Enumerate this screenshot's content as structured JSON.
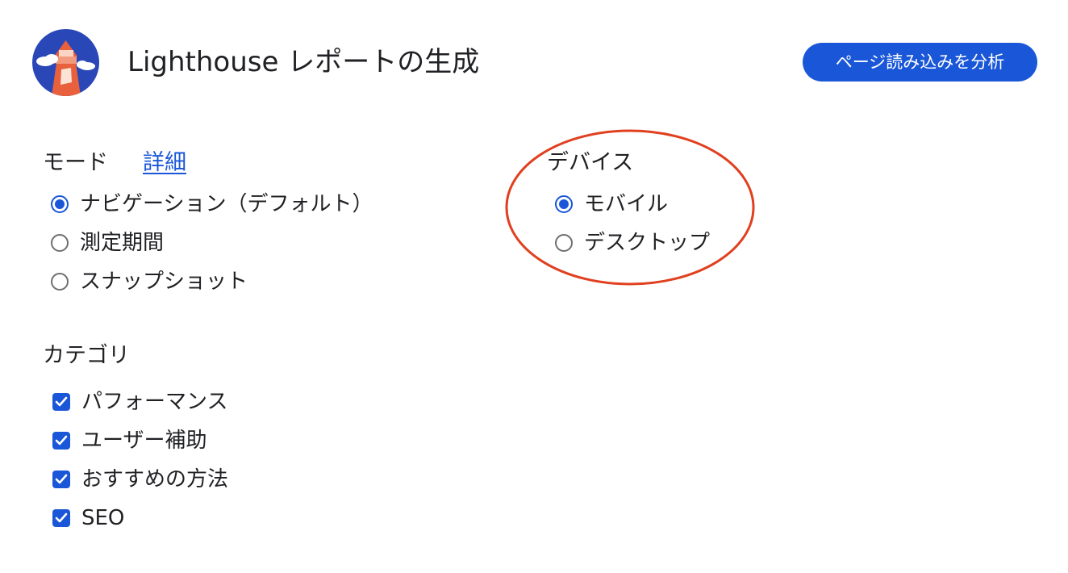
{
  "header": {
    "logo_icon": "lighthouse-logo-icon",
    "title": "Lighthouse レポートの生成",
    "analyze_button_label": "ページ読み込みを分析"
  },
  "mode": {
    "label": "モード",
    "learn_more": "詳細",
    "options": [
      {
        "label": "ナビゲーション（デフォルト）",
        "selected": true
      },
      {
        "label": "測定期間",
        "selected": false
      },
      {
        "label": "スナップショット",
        "selected": false
      }
    ]
  },
  "device": {
    "label": "デバイス",
    "options": [
      {
        "label": "モバイル",
        "selected": true
      },
      {
        "label": "デスクトップ",
        "selected": false
      }
    ]
  },
  "categories": {
    "label": "カテゴリ",
    "items": [
      {
        "label": "パフォーマンス",
        "checked": true
      },
      {
        "label": "ユーザー補助",
        "checked": true
      },
      {
        "label": "おすすめの方法",
        "checked": true
      },
      {
        "label": "SEO",
        "checked": true
      }
    ]
  },
  "colors": {
    "accent": "#1a57d8",
    "annotation_circle": "#e0401f",
    "logo_background": "#2a47b8",
    "logo_tower": "#e8603c"
  }
}
